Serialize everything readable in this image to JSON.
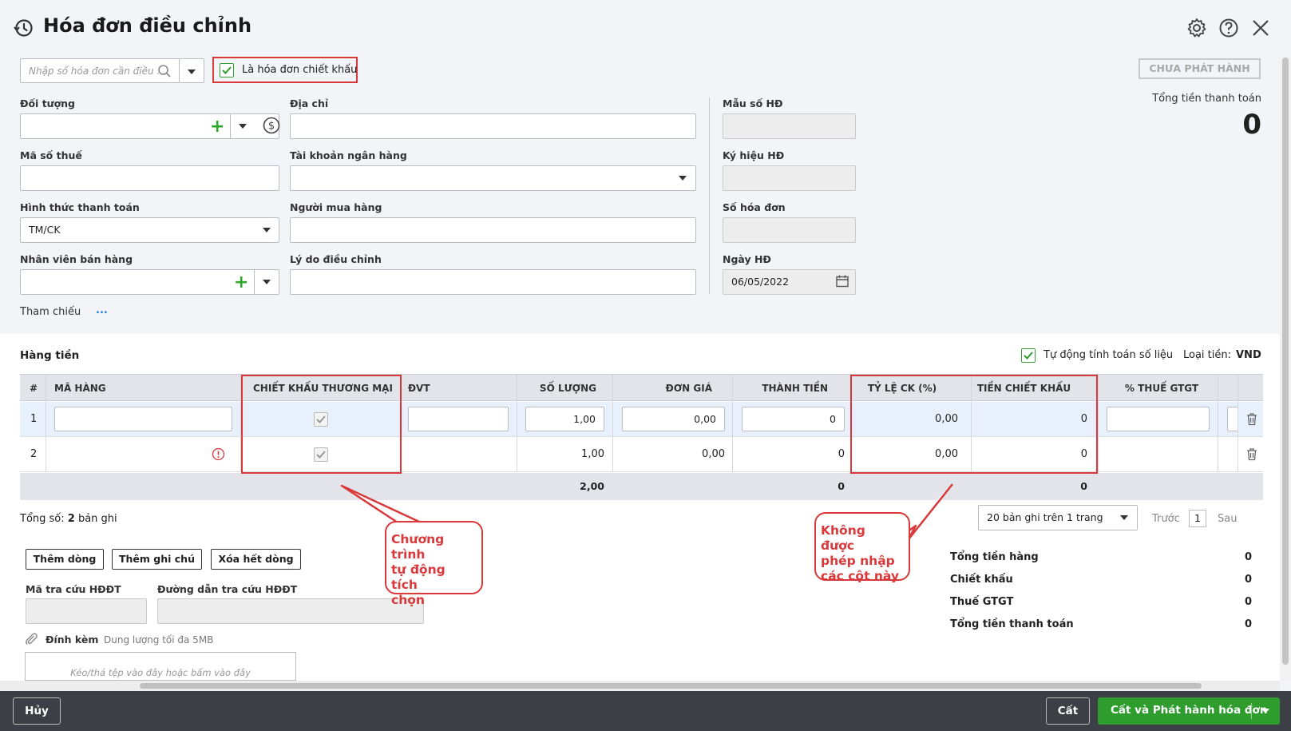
{
  "header": {
    "title": "Hóa đơn điều chỉnh"
  },
  "search": {
    "placeholder": "Nhập số hóa đơn cần điều ..."
  },
  "discount_invoice": {
    "label": "Là hóa đơn chiết khấu",
    "checked": true
  },
  "status_badge": "CHƯA PHÁT HÀNH",
  "total_payment": {
    "label": "Tổng tiền thanh toán",
    "value": "0"
  },
  "form": {
    "doi_tuong": {
      "label": "Đối tượng",
      "value": ""
    },
    "dia_chi": {
      "label": "Địa chỉ",
      "value": ""
    },
    "mau_so": {
      "label": "Mẫu số HĐ",
      "value": ""
    },
    "ma_so_thue": {
      "label": "Mã số thuế",
      "value": ""
    },
    "tai_khoan": {
      "label": "Tài khoản ngân hàng",
      "value": ""
    },
    "ky_hieu": {
      "label": "Ký hiệu HĐ",
      "value": ""
    },
    "hinh_thuc": {
      "label": "Hình thức thanh toán",
      "value": "TM/CK"
    },
    "nguoi_mua": {
      "label": "Người mua hàng",
      "value": ""
    },
    "so_hoa_don": {
      "label": "Số hóa đơn",
      "value": ""
    },
    "nhan_vien": {
      "label": "Nhân viên bán hàng",
      "value": ""
    },
    "ly_do": {
      "label": "Lý do điều chỉnh",
      "value": ""
    },
    "ngay_hd": {
      "label": "Ngày HĐ",
      "value": "06/05/2022"
    },
    "tham_chieu": {
      "label": "Tham chiếu",
      "more": "..."
    }
  },
  "hang_tien": {
    "title": "Hàng tiền",
    "auto_calc_label": "Tự động tính toán số liệu",
    "currency_label": "Loại tiền:",
    "currency": "VND"
  },
  "table": {
    "columns": [
      "#",
      "MÃ HÀNG",
      "CHIẾT KHẤU THƯƠNG MẠI",
      "ĐVT",
      "SỐ LƯỢNG",
      "ĐƠN GIÁ",
      "THÀNH TIỀN",
      "TỶ LỆ CK (%)",
      "TIỀN CHIẾT KHẤU",
      "% THUẾ GTGT"
    ],
    "rows": [
      {
        "no": "1",
        "ma_hang": "",
        "so_luong": "1,00",
        "don_gia": "0,00",
        "thanh_tien": "0",
        "ty_le_ck": "0,00",
        "tien_ck": "0"
      },
      {
        "no": "2",
        "ma_hang": "",
        "so_luong": "1,00",
        "don_gia": "0,00",
        "thanh_tien": "0",
        "ty_le_ck": "0,00",
        "tien_ck": "0"
      }
    ],
    "totals": {
      "so_luong": "2,00",
      "thanh_tien": "0",
      "tien_ck": "0"
    }
  },
  "records": {
    "prefix": "Tổng số:",
    "count": "2",
    "suffix": "bản ghi"
  },
  "pagination": {
    "page_size": "20 bản ghi trên 1 trang",
    "prev": "Trước",
    "page": "1",
    "next": "Sau"
  },
  "buttons": {
    "add_row": "Thêm dòng",
    "add_note": "Thêm ghi chú",
    "delete_all": "Xóa hết dòng"
  },
  "lookup": {
    "code_label": "Mã tra cứu HĐĐT",
    "link_label": "Đường dẫn tra cứu HĐĐT"
  },
  "attach": {
    "label": "Đính kèm",
    "hint": "Dung lượng tối đa 5MB",
    "drop": "Kéo/thả tệp vào đây hoặc bấm vào đây"
  },
  "callouts": {
    "auto_check": [
      "Chương trình",
      "tự động tích",
      "chọn"
    ],
    "no_input": [
      "Không được",
      "phép nhập",
      "các cột này"
    ]
  },
  "summary": [
    {
      "label": "Tổng tiền hàng",
      "value": "0"
    },
    {
      "label": "Chiết khấu",
      "value": "0"
    },
    {
      "label": "Thuế GTGT",
      "value": "0"
    },
    {
      "label": "Tổng tiền thanh toán",
      "value": "0"
    }
  ],
  "footer": {
    "cancel": "Hủy",
    "save": "Cất",
    "save_publish": "Cất và Phát hành hóa đơn"
  },
  "colors": {
    "accent_green": "#2e9d2e",
    "annotation_red": "#d9393b",
    "footer_bg": "#3c3f45"
  }
}
